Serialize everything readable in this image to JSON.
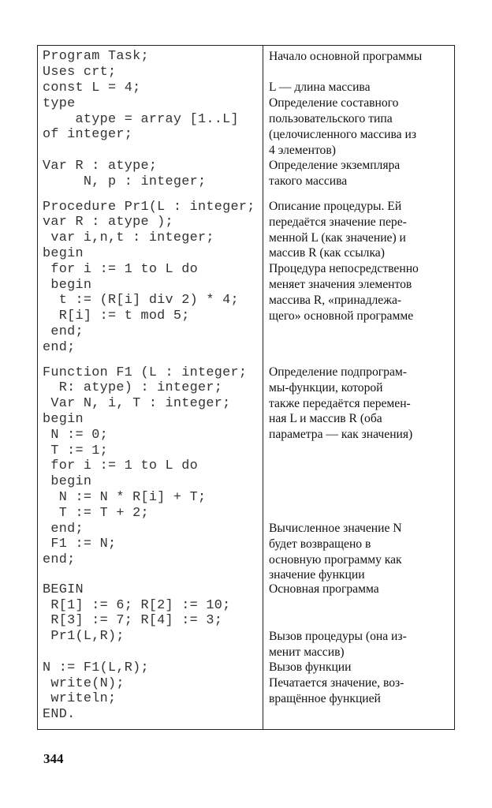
{
  "rows": [
    {
      "code": "Program Task;",
      "note": "Начало основной программы"
    },
    {
      "code": "Uses crt;",
      "note": ""
    },
    {
      "code": "const L = 4;",
      "note": "L — длина массива"
    },
    {
      "code": "type",
      "note": "Определение составного"
    },
    {
      "code": "    atype = array [1..L]",
      "note": "пользовательского типа"
    },
    {
      "code": "of integer;",
      "note": "(целочисленного массива из"
    },
    {
      "code": "",
      "note": "4 элементов)"
    },
    {
      "code": "Var R : atype;",
      "note": "Определение экземпляра"
    },
    {
      "code": "     N, p : integer;",
      "note": "такого массива"
    },
    {
      "gap": 1
    },
    {
      "code": "Procedure Pr1(L : integer;",
      "note": "Описание процедуры. Ей"
    },
    {
      "code": "var R : atype );",
      "note": "передаётся значение пере-"
    },
    {
      "code": " var i,n,t : integer;",
      "note": "менной L (как значение) и"
    },
    {
      "code": "begin",
      "note": "массив R (как ссылка)"
    },
    {
      "code": " for i := 1 to L do",
      "note": "Процедура непосредственно"
    },
    {
      "code": " begin",
      "note": "меняет значения элементов"
    },
    {
      "code": "  t := (R[i] div 2) * 4;",
      "note": "массива R, «принадлежа-"
    },
    {
      "code": "  R[i] := t mod 5;",
      "note": "щего» основной программе"
    },
    {
      "code": " end;",
      "note": ""
    },
    {
      "code": "end;",
      "note": ""
    },
    {
      "gap": 1
    },
    {
      "code": "Function F1 (L : integer;",
      "note": "Определение подпрограм-"
    },
    {
      "code": "  R: atype) : integer;",
      "note": "мы-функции, которой"
    },
    {
      "code": " Var N, i, T : integer;",
      "note": "также передаётся перемен-"
    },
    {
      "code": "begin",
      "note": "ная L и массив R (оба"
    },
    {
      "code": " N := 0;",
      "note": "параметра — как значения)"
    },
    {
      "code": " T := 1;",
      "note": ""
    },
    {
      "code": " for i := 1 to L do",
      "note": ""
    },
    {
      "code": " begin",
      "note": ""
    },
    {
      "code": "  N := N * R[i] + T;",
      "note": ""
    },
    {
      "code": "  T := T + 2;",
      "note": ""
    },
    {
      "code": " end;",
      "note": "Вычисленное значение N"
    },
    {
      "code": " F1 := N;",
      "note": "будет возвращено в"
    },
    {
      "code": "end;",
      "note": "основную программу как"
    },
    {
      "code": "",
      "note": "значение функции",
      "gap2": 1
    },
    {
      "code": "BEGIN",
      "note": "Основная программа"
    },
    {
      "code": " R[1] := 6; R[2] := 10;",
      "note": ""
    },
    {
      "code": " R[3] := 7; R[4] := 3;",
      "note": ""
    },
    {
      "code": " Pr1(L,R);",
      "note": "Вызов процедуры (она из-"
    },
    {
      "code": "",
      "note": "менит массив)"
    },
    {
      "code": "N := F1(L,R);",
      "note": "Вызов функции"
    },
    {
      "code": " write(N);",
      "note": "Печатается значение, воз-"
    },
    {
      "code": " writeln;",
      "note": "вращённое функцией"
    },
    {
      "code": "END.",
      "note": ""
    }
  ],
  "page_number": "344"
}
